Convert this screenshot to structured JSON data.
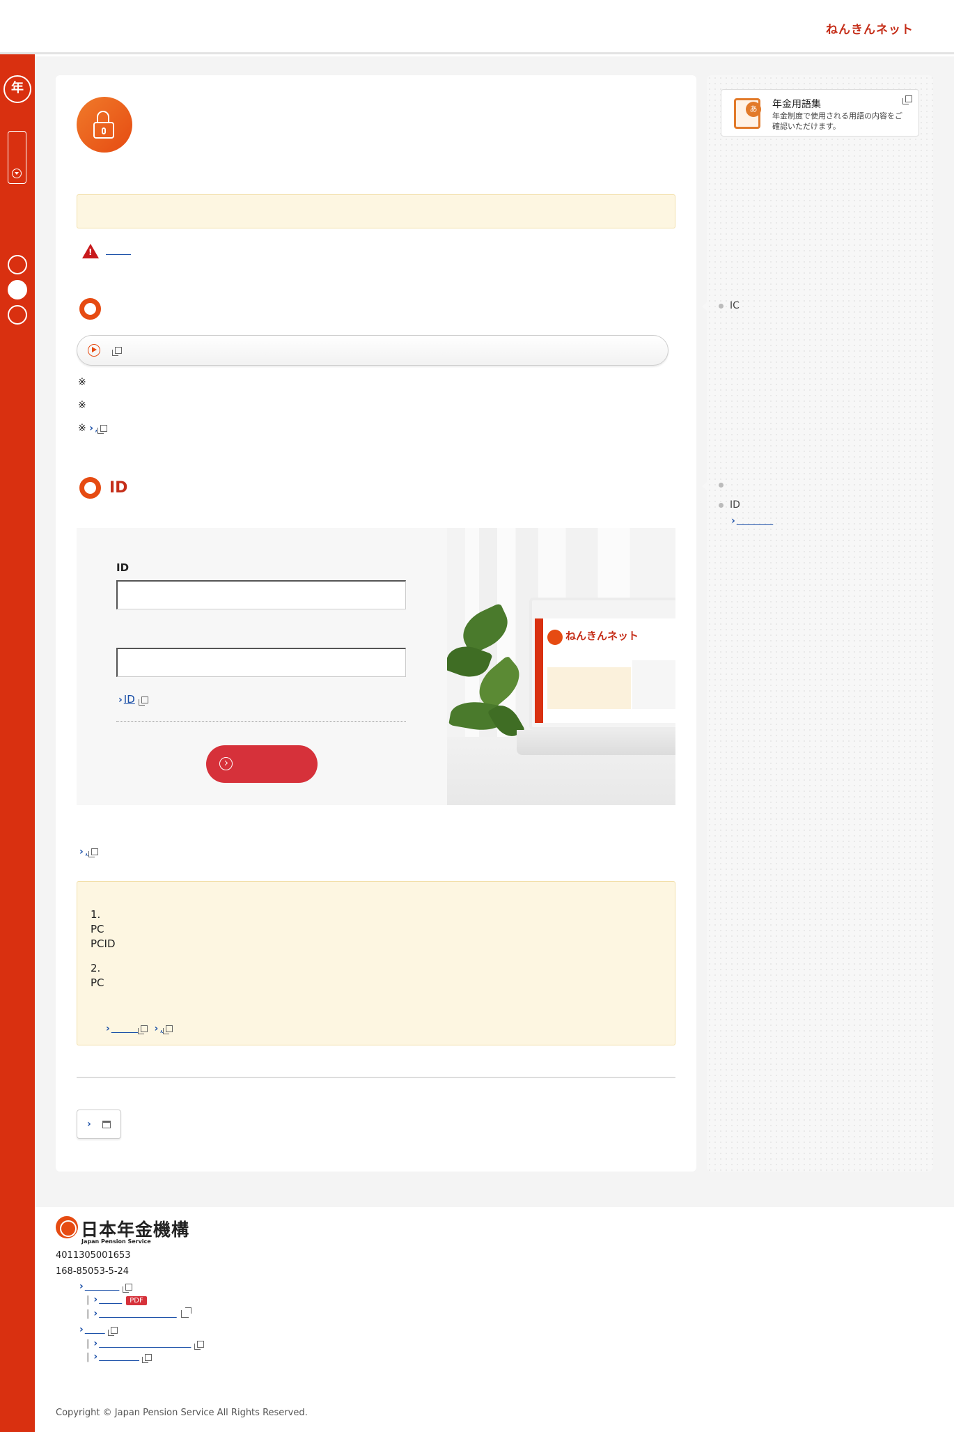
{
  "header": {
    "brand": "ねんきんネット"
  },
  "sections": [
    {
      "title": ""
    },
    {
      "title": "ID"
    }
  ],
  "notes": [
    "※",
    "※",
    "※"
  ],
  "login": {
    "id_label": "ID",
    "id_value": "",
    "pw_value": "",
    "forgot_link": "ID",
    "submit_label": ""
  },
  "info": {
    "item1_num": "1.",
    "item1_line1": "PC",
    "item1_line2": "PCID",
    "item2_num": "2.",
    "item2_line1": "PC"
  },
  "glossary": {
    "title": "年金用語集",
    "desc": "年金制度で使用される用語の内容をご確認いただけます。",
    "icon": "book-icon"
  },
  "right_list": [
    {
      "text": "IC"
    },
    {
      "text": ""
    },
    {
      "text": "ID"
    }
  ],
  "footer": {
    "org_name": "日本年金機構",
    "org_name_en": "Japan Pension Service",
    "number1": "4011305001653",
    "number2": "168-85053-5-24",
    "pdf_badge": "PDF",
    "copyright": "Copyright © Japan Pension Service All Rights Reserved."
  },
  "colors": {
    "brand": "#d93010",
    "accent": "#e64b12",
    "notice_bg": "#fdf6e1",
    "link": "#1a4fa8"
  },
  "icons": [
    "unlock-icon",
    "warning-icon",
    "play-icon",
    "new-window-icon",
    "external-link-icon",
    "calendar-icon",
    "chevron-right-icon"
  ]
}
